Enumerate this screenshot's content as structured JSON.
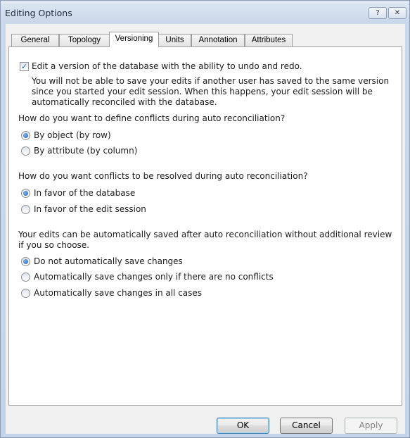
{
  "window": {
    "title": "Editing Options",
    "help_glyph": "?",
    "close_glyph": "✕"
  },
  "tabs": [
    {
      "label": "General",
      "active": false
    },
    {
      "label": "Topology",
      "active": false
    },
    {
      "label": "Versioning",
      "active": true
    },
    {
      "label": "Units",
      "active": false
    },
    {
      "label": "Annotation",
      "active": false
    },
    {
      "label": "Attributes",
      "active": false
    }
  ],
  "versioning": {
    "edit_version_checkbox": {
      "label": "Edit a version of the database with the ability to undo and redo.",
      "checked": true
    },
    "info_text": "You will not be able to save your edits if another user has saved to the same version since you started your edit session. When this happens, your edit session will be automatically reconciled with the database.",
    "conflict_definition": {
      "question": "How do you want to define conflicts during auto reconciliation?",
      "options": [
        {
          "label": "By object (by row)",
          "selected": true
        },
        {
          "label": "By attribute (by column)",
          "selected": false
        }
      ]
    },
    "conflict_resolution": {
      "question": "How do you want conflicts to be resolved during auto reconciliation?",
      "options": [
        {
          "label": "In favor of the database",
          "selected": true
        },
        {
          "label": "In favor of the edit session",
          "selected": false
        }
      ]
    },
    "autosave": {
      "question": "Your edits can be automatically saved after auto reconciliation without additional review if you so choose.",
      "options": [
        {
          "label": "Do not automatically save changes",
          "selected": true
        },
        {
          "label": "Automatically save changes only if there are no conflicts",
          "selected": false
        },
        {
          "label": "Automatically save changes in all cases",
          "selected": false
        }
      ]
    }
  },
  "buttons": {
    "ok": "OK",
    "cancel": "Cancel",
    "apply": "Apply"
  }
}
